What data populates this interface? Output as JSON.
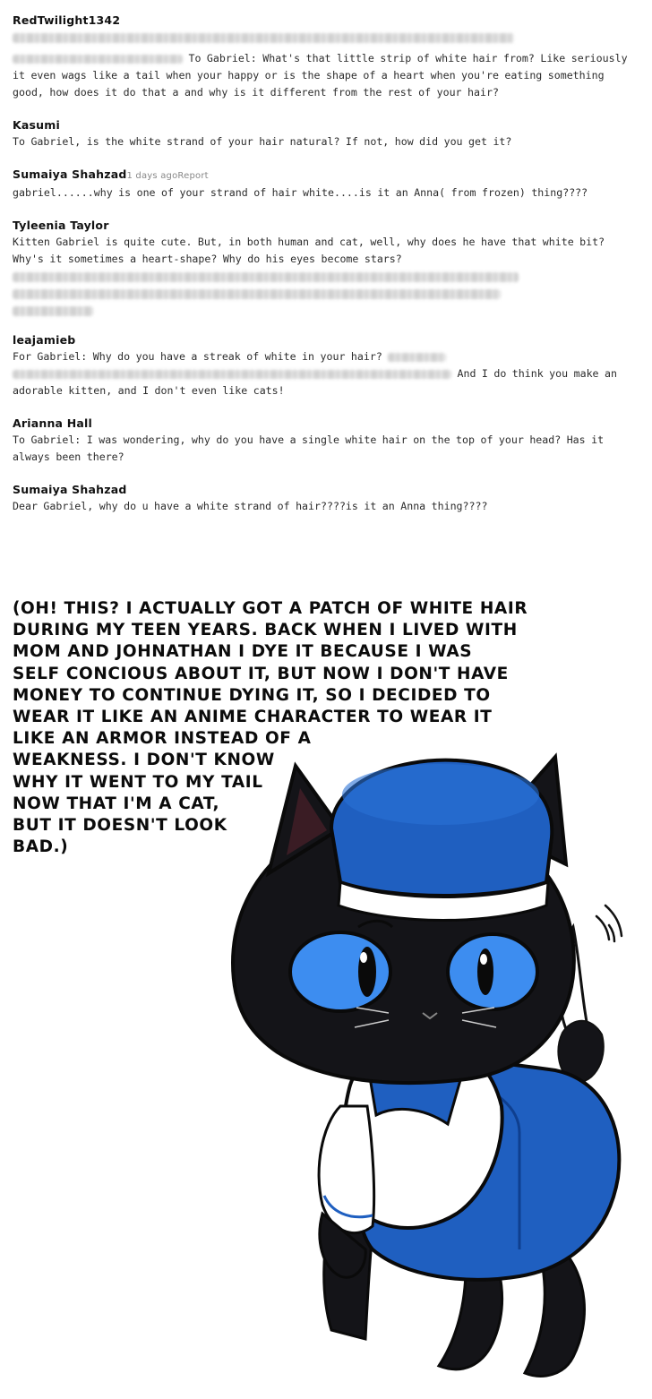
{
  "comments": [
    {
      "author": "RedTwilight1342",
      "meta": "",
      "text_lead": "To Gabriel: What's that little strip of white hair from? Like seriously it even wags like a tail when your happy or is the shape of a heart when you're eating something good, how does it do that a and why is it different from the rest of your hair?",
      "text_tail": ""
    },
    {
      "author": "Kasumi",
      "meta": "",
      "text_lead": "To Gabriel, is the white strand of your hair natural? If not, how did you get it?",
      "text_tail": ""
    },
    {
      "author": "Sumaiya Shahzad",
      "meta": "1 days agoReport",
      "text_lead": "gabriel......why is one of your strand of hair white....is it an Anna( from frozen) thing????",
      "text_tail": ""
    },
    {
      "author": "Tyleenia Taylor",
      "meta": "",
      "text_lead": "Kitten Gabriel is quite cute. But, in both human and cat, well, why does he have that white bit? Why's it sometimes a heart-shape? Why do his eyes become stars?",
      "text_tail": ""
    },
    {
      "author": "leajamieb",
      "meta": "",
      "text_lead": "For Gabriel: Why do you have a streak of white in your hair?",
      "text_tail": "And I do think you make an adorable kitten, and I don't even like cats!"
    },
    {
      "author": "Arianna Hall",
      "meta": "",
      "text_lead": "To Gabriel: I was wondering, why do you have a single white hair on the top of your head? Has it always been there?",
      "text_tail": ""
    },
    {
      "author": "Sumaiya Shahzad",
      "meta": "",
      "text_lead": "Dear Gabriel, why do u have a white strand of hair????is it an Anna thing????",
      "text_tail": ""
    }
  ],
  "answer_lines": [
    "(OH! THIS? I ACTUALLY GOT A PATCH OF WHITE HAIR",
    "DURING MY TEEN YEARS. BACK WHEN I LIVED WITH",
    "MOM AND JOHNATHAN I DYE IT BECAUSE I WAS",
    "SELF CONCIOUS ABOUT IT, BUT NOW I DON'T HAVE",
    "MONEY TO CONTINUE DYING IT, SO I DECIDED TO",
    "WEAR IT LIKE AN ANIME CHARACTER TO WEAR IT",
    "LIKE AN ARMOR INSTEAD OF A",
    "WEAKNESS. I DON'T KNOW",
    "WHY IT WENT TO MY TAIL",
    "NOW THAT I'M A  CAT,",
    "BUT IT DOESN'T LOOK",
    "BAD.)"
  ],
  "colors": {
    "hat_blue": "#1f5fc0",
    "cat_black": "#141418",
    "eye_blue": "#3d8df0"
  }
}
